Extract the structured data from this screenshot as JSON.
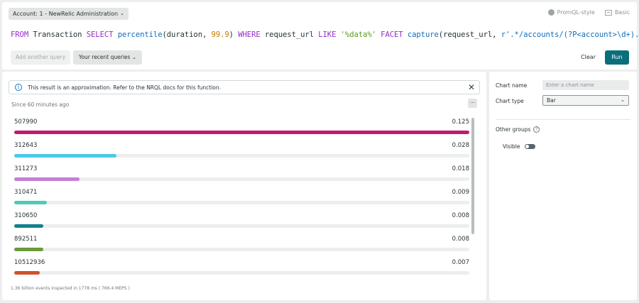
{
  "header": {
    "account_label": "Account: 1 - NewRelic Administration",
    "modes": [
      {
        "label": "PromQL-style",
        "icon": "promql-icon"
      },
      {
        "label": "Basic",
        "icon": "basic-mode-icon"
      }
    ]
  },
  "query": {
    "tokens": [
      {
        "text": "FROM",
        "kind": "kw"
      },
      {
        "text": " Transaction ",
        "kind": "plain"
      },
      {
        "text": "SELECT",
        "kind": "kw"
      },
      {
        "text": " ",
        "kind": "plain"
      },
      {
        "text": "percentile",
        "kind": "fn"
      },
      {
        "text": "(duration, ",
        "kind": "plain"
      },
      {
        "text": "99.9",
        "kind": "num"
      },
      {
        "text": ") ",
        "kind": "plain"
      },
      {
        "text": "WHERE",
        "kind": "kw"
      },
      {
        "text": " request_url ",
        "kind": "plain"
      },
      {
        "text": "LIKE",
        "kind": "kw"
      },
      {
        "text": " ",
        "kind": "plain"
      },
      {
        "text": "'%data%'",
        "kind": "str"
      },
      {
        "text": " ",
        "kind": "plain"
      },
      {
        "text": "FACET",
        "kind": "kw"
      },
      {
        "text": " ",
        "kind": "plain"
      },
      {
        "text": "capture",
        "kind": "fn"
      },
      {
        "text": "(request_url, ",
        "kind": "plain"
      },
      {
        "text": "r'.*/accounts/(?P<account>\\d+).*'",
        "kind": "fn"
      },
      {
        "text": ")",
        "kind": "plain"
      }
    ],
    "add_query_label": "Add another query",
    "recent_queries_label": "Your recent queries",
    "clear_label": "Clear",
    "run_label": "Run"
  },
  "results": {
    "notice": "This result is an approximation. Refer to the NRQL docs for this function.",
    "since": "Since 60 minutes ago",
    "more_label": "...",
    "rows": [
      {
        "label": "507990",
        "value": "0.125",
        "fraction": 1.0,
        "color": "#c2186f"
      },
      {
        "label": "312643",
        "value": "0.028",
        "fraction": 0.224,
        "color": "#4dc9e8"
      },
      {
        "label": "311273",
        "value": "0.018",
        "fraction": 0.144,
        "color": "#c47ed6"
      },
      {
        "label": "310471",
        "value": "0.009",
        "fraction": 0.072,
        "color": "#4fcab4"
      },
      {
        "label": "310650",
        "value": "0.008",
        "fraction": 0.064,
        "color": "#13808e"
      },
      {
        "label": "892511",
        "value": "0.008",
        "fraction": 0.064,
        "color": "#6a9a3b"
      },
      {
        "label": "10512936",
        "value": "0.007",
        "fraction": 0.056,
        "color": "#d0522b"
      }
    ],
    "footer": "1.36 billion events inspected in 1778 ms ( 766.4 MEPS )"
  },
  "config": {
    "chart_name_label": "Chart name",
    "chart_name_placeholder": "Enter a chart name",
    "chart_type_label": "Chart type",
    "chart_type_value": "Bar",
    "other_groups_label": "Other groups",
    "visible_label": "Visible"
  }
}
